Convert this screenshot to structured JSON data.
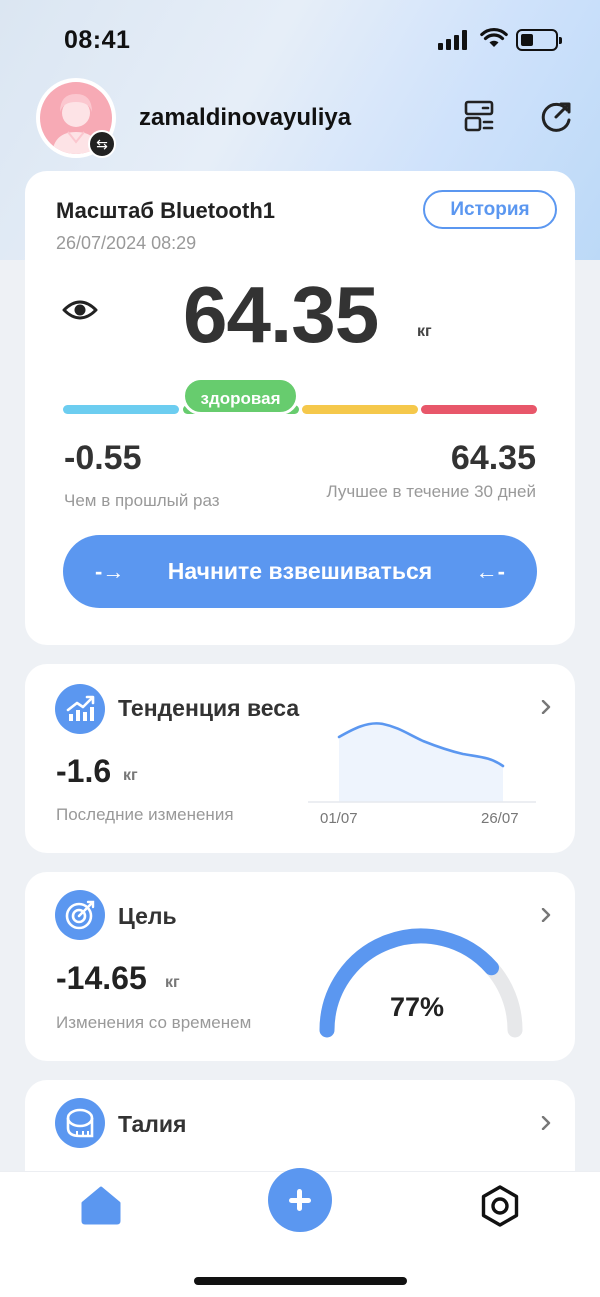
{
  "status_bar": {
    "time": "08:41"
  },
  "header": {
    "username": "zamaldinovayuliya"
  },
  "main_card": {
    "scale_name": "Масштаб Bluetooth1",
    "datetime": "26/07/2024 08:29",
    "history_label": "История",
    "weight_value": "64.35",
    "weight_unit": "кг",
    "bmi_status": "здоровая",
    "diff_value": "-0.55",
    "diff_label": "Чем в прошлый раз",
    "best_value": "64.35",
    "best_label": "Лучшее в течение 30 дней",
    "start_label": "Начните взвешиваться",
    "arrow_left": "-→",
    "arrow_right": "←-",
    "colors": {
      "blue": "#6ccdf0",
      "yellow": "#f5c84b",
      "red": "#e8576a",
      "green": "#67cc6e"
    }
  },
  "trend_card": {
    "title": "Тенденция веса",
    "value": "-1.6",
    "unit": "кг",
    "label": "Последние изменения",
    "start_date": "01/07",
    "end_date": "26/07"
  },
  "goal_card": {
    "title": "Цель",
    "value": "-14.65",
    "unit": "кг",
    "label": "Изменения со временем",
    "progress_text": "77%",
    "progress": 0.77
  },
  "waist_card": {
    "title": "Талия"
  },
  "theme": {
    "accent": "#5b97f0"
  }
}
